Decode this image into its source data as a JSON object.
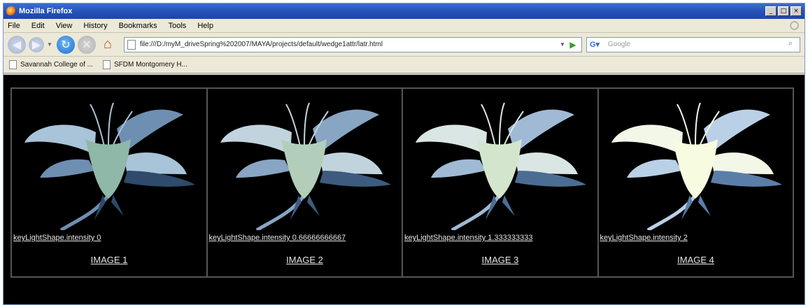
{
  "window": {
    "title": "Mozilla Firefox",
    "controls": [
      "minimize",
      "maximize",
      "close"
    ]
  },
  "menu": [
    "File",
    "Edit",
    "View",
    "History",
    "Bookmarks",
    "Tools",
    "Help"
  ],
  "nav": {
    "url": "file:///D:/myM_driveSpring%202007/MAYA/projects/default/wedge1attr/latr.html",
    "search_placeholder": "Google"
  },
  "bookmarks": [
    "Savannah College of ...",
    "SFDM Montgomery H..."
  ],
  "cells": [
    {
      "caption": "keyLightShape.intensity 0",
      "link": "IMAGE 1",
      "brightness": 0
    },
    {
      "caption": "keyLightShape.intensity 0.66666666667",
      "link": "IMAGE 2",
      "brightness": 0.6667
    },
    {
      "caption": "keyLightShape.intensity 1.333333333",
      "link": "IMAGE 3",
      "brightness": 1.3333
    },
    {
      "caption": "keyLightShape.intensity 2",
      "link": "IMAGE 4",
      "brightness": 2
    }
  ],
  "colors": {
    "titlebar": "#2553b8",
    "content_bg": "#000000",
    "link_text": "#e6e6e6"
  }
}
